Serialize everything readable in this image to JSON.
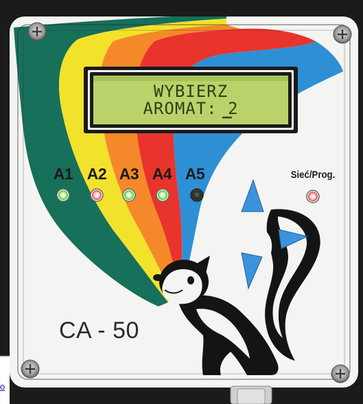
{
  "lcd": {
    "line1": "WYBIERZ",
    "line2": "AROMAT: 2"
  },
  "leds": [
    {
      "label": "A1",
      "color": "#7cff4a",
      "state": "on"
    },
    {
      "label": "A2",
      "color": "#ff6a6a",
      "state": "on"
    },
    {
      "label": "A3",
      "color": "#7cff4a",
      "state": "on"
    },
    {
      "label": "A4",
      "color": "#7cff4a",
      "state": "on"
    },
    {
      "label": "A5",
      "color": "#2e3a2e",
      "state": "off"
    }
  ],
  "power_led": {
    "label": "Sieć/Prog.",
    "color": "#ff6a6a",
    "state": "on"
  },
  "device": {
    "model": "CA - 50"
  },
  "edge_link": {
    "text": "o"
  },
  "colors": {
    "case": "#f4f4f2",
    "rainbow": [
      "#17705a",
      "#f2e22c",
      "#f5892a",
      "#e8342c",
      "#2f8fd4"
    ],
    "lcd_background": "#b9d36a",
    "skunk_arrows": "#3b93dc"
  }
}
